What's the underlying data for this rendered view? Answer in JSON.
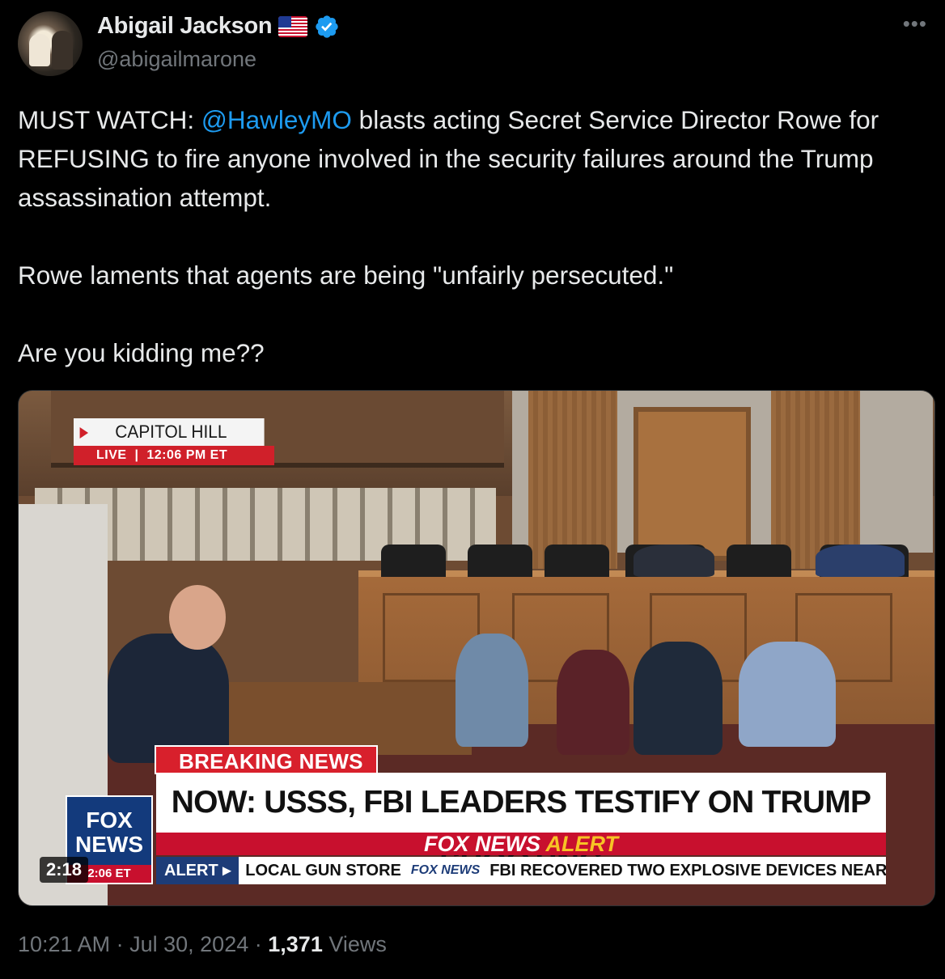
{
  "author": {
    "name": "Abigail Jackson",
    "handle": "@abigailmarone",
    "flag_emoji": "🇺🇸",
    "verified": true,
    "more_icon": "more-horizontal-icon"
  },
  "tweet": {
    "segments": [
      {
        "type": "text",
        "value": "MUST WATCH: "
      },
      {
        "type": "mention",
        "value": "@HawleyMO"
      },
      {
        "type": "text",
        "value": " blasts acting Secret Service Director Rowe for REFUSING to fire anyone involved in the security failures around the Trump assassination attempt."
      }
    ],
    "paragraph2": "Rowe laments that agents are being \"unfairly persecuted.\"",
    "paragraph3": "Are you kidding me??"
  },
  "video": {
    "duration": "2:18",
    "overlay": {
      "location": "CAPITOL HILL",
      "live": "LIVE",
      "live_time": "12:06 PM ET",
      "breaking": "BREAKING NEWS",
      "headline": "NOW: USSS, FBI LEADERS TESTIFY ON TRUMP SHOOTING",
      "alert_brand": "FOX NEWS",
      "alert_word": "ALERT",
      "ticker_tag": "ALERT ▸",
      "ticker_item1": "LOCAL GUN STORE",
      "ticker_sep": "FOX NEWS",
      "ticker_item2": "FBI RECOVERED TWO EXPLOSIVE DEVICES NEAR",
      "logo_line1": "FOX",
      "logo_line2": "NEWS",
      "logo_time": "2:06 ET"
    }
  },
  "meta": {
    "time": "10:21 AM",
    "date": "Jul 30, 2024",
    "views_count": "1,371",
    "views_label": "Views",
    "separator": "·"
  },
  "colors": {
    "background": "#000000",
    "text": "#e7e9ea",
    "muted": "#71767b",
    "link": "#1d9bf0",
    "fox_red": "#c8102e",
    "fox_blue": "#133a7c"
  }
}
